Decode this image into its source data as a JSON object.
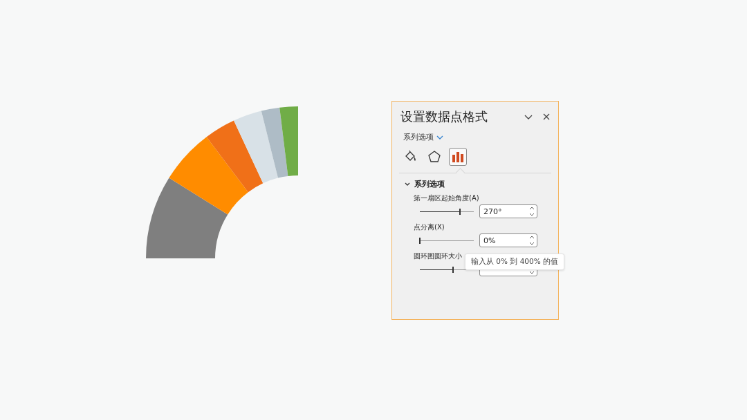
{
  "panel": {
    "title": "设置数据点格式",
    "options_menu": "系列选项",
    "tabs": [
      {
        "kind": "fill",
        "selected": false
      },
      {
        "kind": "effects",
        "selected": false
      },
      {
        "kind": "series",
        "selected": true
      }
    ],
    "section": {
      "title": "系列选项",
      "expanded": true
    },
    "settings": [
      {
        "label": "第一扇区起始角度(A)",
        "level": 0.74,
        "value": "270°"
      },
      {
        "label": "点分离(X)",
        "level": 0,
        "value": "0%"
      },
      {
        "label": "圆环图圆环大小",
        "level": 0.62
      }
    ],
    "tooltip": "输入从 0% 到 400% 的值"
  }
}
